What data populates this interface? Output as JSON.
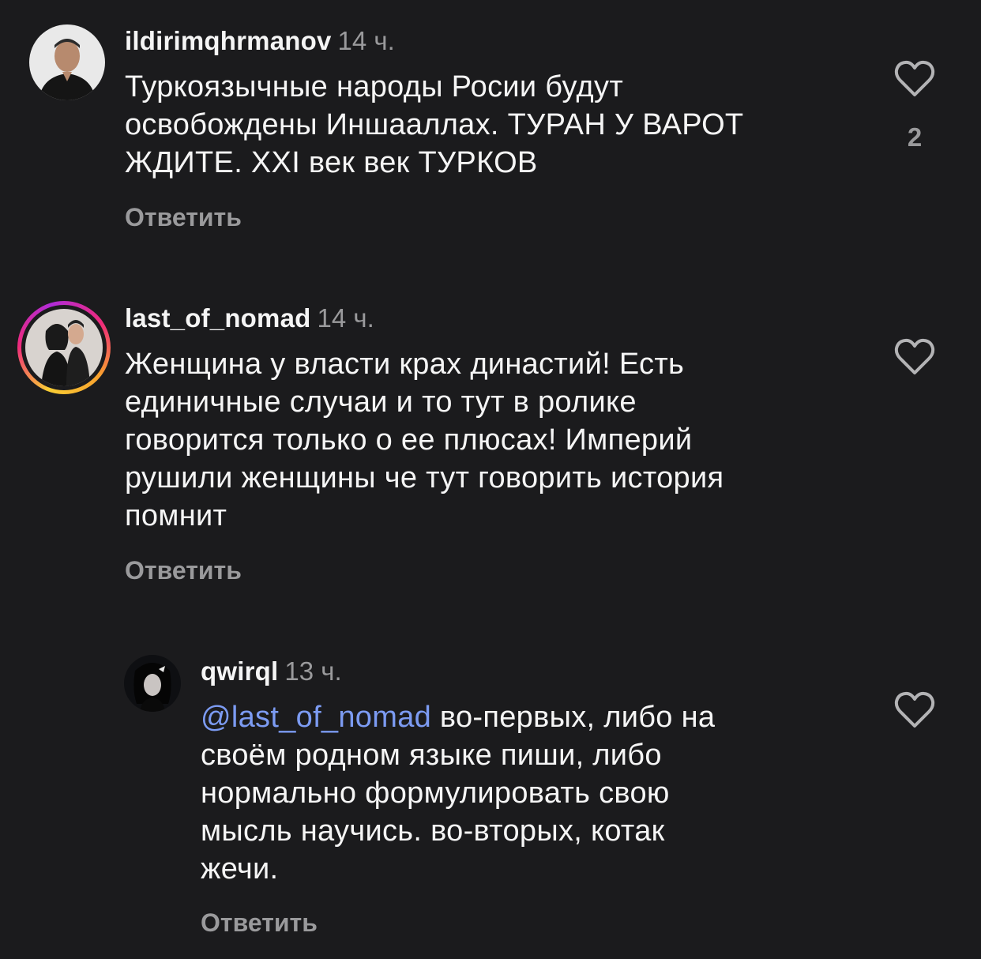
{
  "comments": [
    {
      "username": "ildirimqhrmanov",
      "time": "14 ч.",
      "lines": [
        "Туркоязычные народы Росии будут",
        "освобождены Иншааллах. ТУРАН У ВАРОТ",
        "ЖДИТЕ. XXI век век ТУРКОВ"
      ],
      "reply_label": "Ответить",
      "like_count": "2",
      "avatar_icon": "profile-photo"
    },
    {
      "username": "last_of_nomad",
      "time": "14 ч.",
      "lines": [
        "Женщина у власти крах династий! Есть",
        "единичные случаи и то тут в ролике",
        "говорится только о ее плюсах! Империй",
        "рушили женщины че тут говорить история",
        "помнит"
      ],
      "reply_label": "Ответить",
      "avatar_icon": "profile-photo-story-ring"
    },
    {
      "username": "qwirql",
      "time": "13 ч.",
      "mention": "@last_of_nomad",
      "first_line_rest": " во-первых, либо на",
      "lines": [
        "своём родном языке пиши, либо",
        "нормально формулировать свою",
        "мысль научись. во-вторых, котак",
        "жечи."
      ],
      "reply_label": "Ответить",
      "avatar_icon": "profile-photo"
    }
  ],
  "colors": {
    "background": "#1b1b1d",
    "primary_text": "#f5f5f5",
    "secondary_text": "#9a9a9c",
    "mention": "#7c9bf2"
  },
  "icons": {
    "like": "heart-outline-icon"
  }
}
